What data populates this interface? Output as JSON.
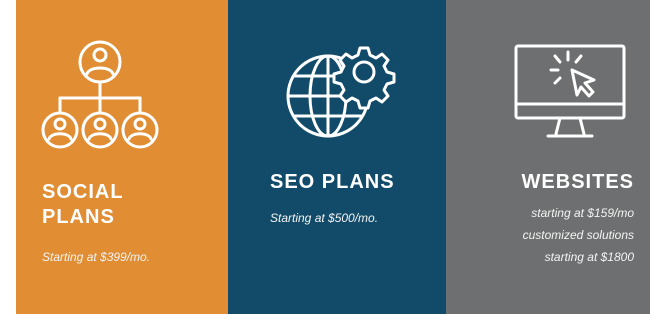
{
  "panels": [
    {
      "title": "SOCIAL PLANS",
      "title_lines": [
        "SOCIAL",
        "PLANS"
      ],
      "subtitle_lines": [
        "Starting at $399/mo."
      ],
      "icon": "people-network-icon",
      "color": "#E08D34"
    },
    {
      "title": "SEO PLANS",
      "subtitle_lines": [
        "Starting at $500/mo."
      ],
      "icon": "globe-gear-icon",
      "color": "#124B69"
    },
    {
      "title": "WEBSITES",
      "subtitle_lines": [
        "starting at $159/mo",
        "customized solutions",
        "starting at $1800"
      ],
      "icon": "monitor-cursor-icon",
      "color": "#6E6F70"
    }
  ]
}
